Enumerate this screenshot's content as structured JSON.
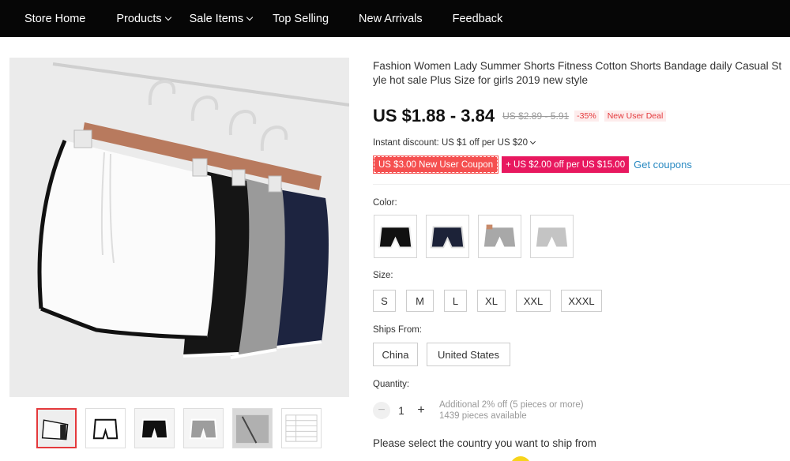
{
  "nav": {
    "items": [
      {
        "label": "Store Home",
        "has_dropdown": false
      },
      {
        "label": "Products",
        "has_dropdown": true
      },
      {
        "label": "Sale Items",
        "has_dropdown": true
      },
      {
        "label": "Top Selling",
        "has_dropdown": false
      },
      {
        "label": "New Arrivals",
        "has_dropdown": false
      },
      {
        "label": "Feedback",
        "has_dropdown": false
      }
    ],
    "background": "#060606"
  },
  "product": {
    "title": "Fashion Women Lady Summer Shorts Fitness Cotton Shorts Bandage daily Casual Style hot sale Plus Size for girls 2019 new style",
    "price": "US $1.88 - 3.84",
    "original_price": "US $2.89 - 5.91",
    "discount": "-35%",
    "deal_badge": "New User Deal",
    "instant_discount": "Instant discount: US $1 off per US $20",
    "coupons": [
      "US $3.00 New User Coupon",
      "+ US $2.00 off per US $15.00"
    ],
    "get_coupons": "Get coupons"
  },
  "options": {
    "color_label": "Color:",
    "colors": [
      "black",
      "navy",
      "gray",
      "light-gray"
    ],
    "size_label": "Size:",
    "sizes": [
      "S",
      "M",
      "L",
      "XL",
      "XXL",
      "XXXL"
    ],
    "ships_from_label": "Ships From:",
    "ships_from": [
      "China",
      "United States"
    ],
    "quantity_label": "Quantity:",
    "quantity": "1",
    "quantity_note": "Additional 2% off (5 pieces or more)",
    "stock": "1439 pieces available"
  },
  "ship_note": "Please select the country you want to ship from",
  "gallery": {
    "thumbnail_count": 6,
    "active_index": 0
  },
  "colors": {
    "price_red": "#e4393c",
    "coupon_red": "#f55050",
    "coupon_pink": "#e8185f",
    "link_blue": "#2a8ac2"
  }
}
